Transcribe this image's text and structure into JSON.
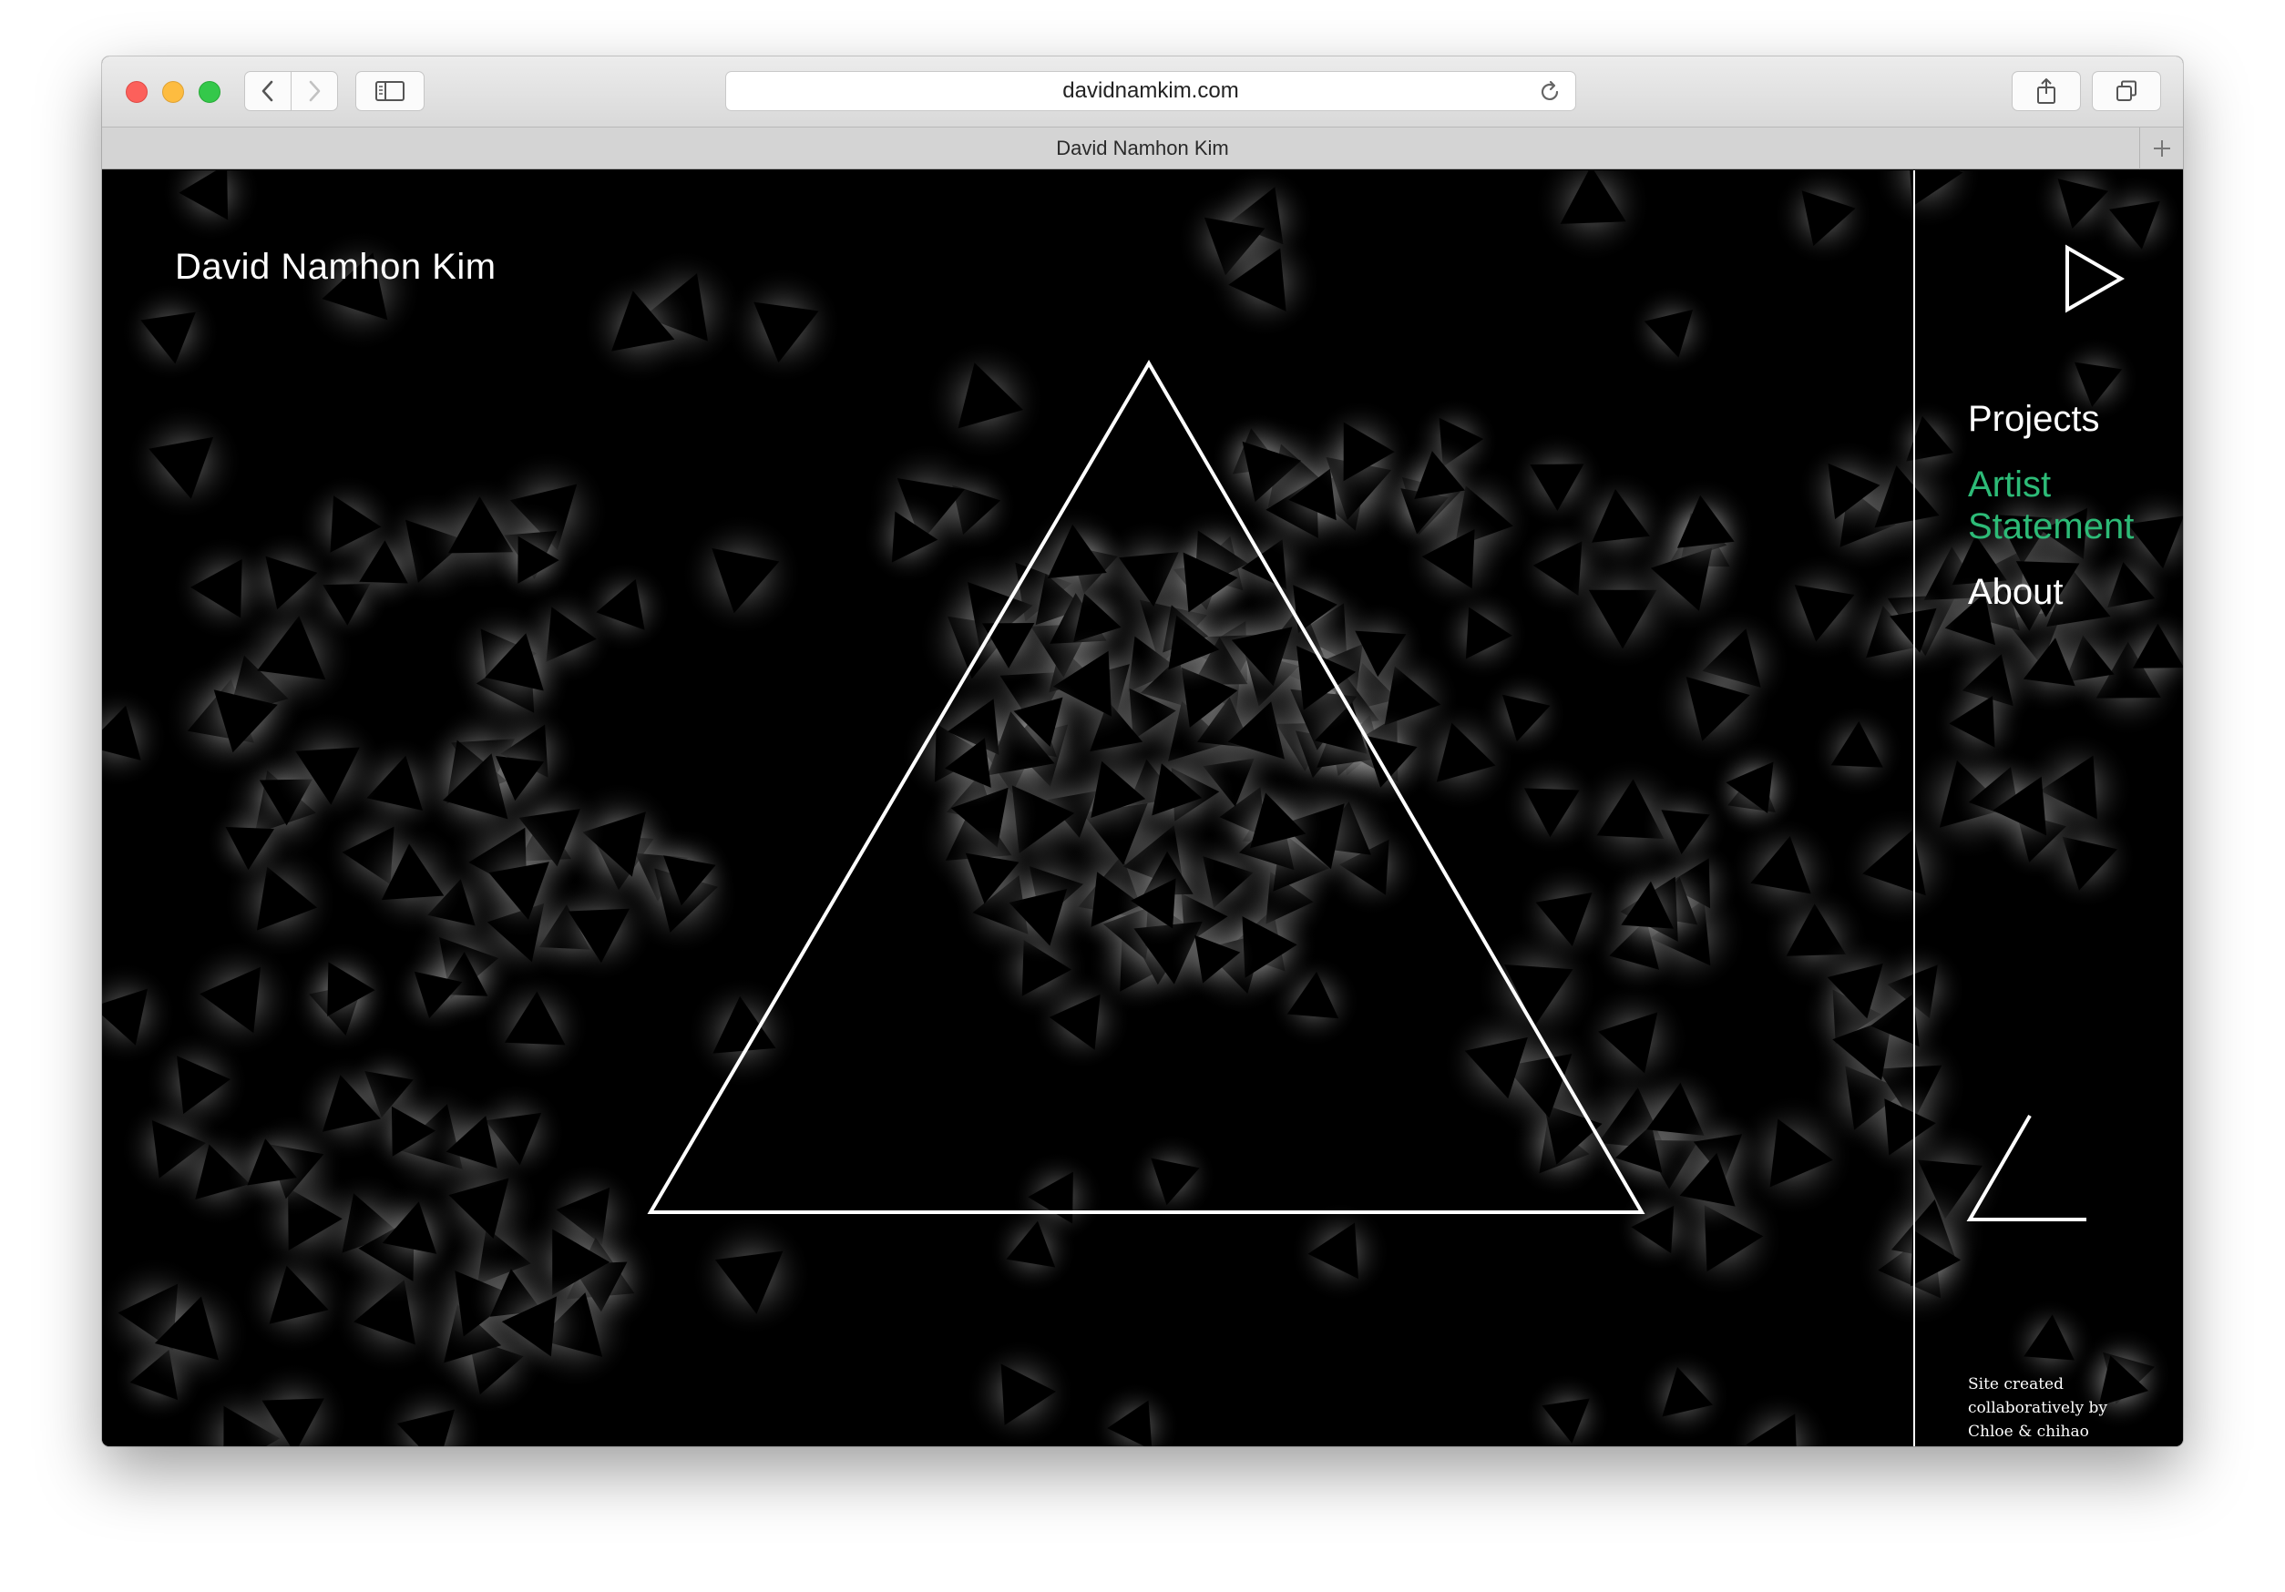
{
  "browser": {
    "url": "davidnamkim.com",
    "tab_title": "David Namhon Kim"
  },
  "site": {
    "title": "David Namhon Kim",
    "nav": [
      {
        "label": "Projects",
        "active": false
      },
      {
        "label": "Artist Statement",
        "active": true
      },
      {
        "label": "About",
        "active": false
      }
    ],
    "credit": "Site created collaboratively by Chloe & chihao"
  },
  "colors": {
    "background": "#000000",
    "foreground": "#ffffff",
    "accent": "#2dbb77"
  },
  "icons": {
    "hero": "outline-triangle",
    "play": "play-outline-icon",
    "corner": "angle-line-icon",
    "particles": "filled-triangle-with-glow"
  }
}
